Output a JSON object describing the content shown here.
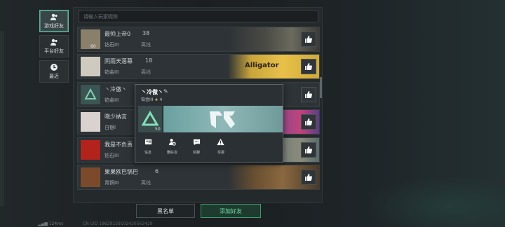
{
  "sidebar": {
    "tabs": [
      {
        "label": "游戏好友",
        "icon": "users-icon",
        "active": true
      },
      {
        "label": "平台好友",
        "icon": "users-icon",
        "active": false
      },
      {
        "label": "最近",
        "icon": "clock-icon",
        "active": false
      }
    ]
  },
  "search": {
    "placeholder": "请输入玩家昵称"
  },
  "friends": [
    {
      "name": "最帅上帝0",
      "count": "38",
      "rank": "钻石III",
      "status": "离线",
      "level": "60"
    },
    {
      "name": "阴雨天落幕",
      "count": "18",
      "rank": "铂金III",
      "status": "离线",
      "level": "",
      "banner_text": "Alligator"
    },
    {
      "name": "丶冷傲丶",
      "count": "",
      "rank": "铂金III",
      "status": "",
      "level": ""
    },
    {
      "name": "晓少纳言",
      "count": "",
      "rank": "白银I",
      "status": "",
      "level": ""
    },
    {
      "name": "我是不负责",
      "count": "",
      "rank": "钻石III",
      "status": "",
      "level": ""
    },
    {
      "name": "果果欧巴锅巴",
      "count": "6",
      "rank": "青铜III",
      "status": "离线",
      "level": ""
    }
  ],
  "popup": {
    "name": "丶冷傲丶",
    "rank": "铂金III",
    "stars": "4",
    "level": "50",
    "actions": [
      {
        "label": "信息",
        "icon": "profile-card-icon"
      },
      {
        "label": "删好友",
        "icon": "remove-user-icon"
      },
      {
        "label": "私聊",
        "icon": "chat-icon"
      },
      {
        "label": "举报",
        "icon": "warning-icon"
      }
    ]
  },
  "buttons": {
    "blacklist": "黑名单",
    "add_friend": "添加好友"
  },
  "footer": {
    "ping": "124ms",
    "uid": "CN UID 18629159102420562429"
  },
  "colors": {
    "accent": "#5fd39a",
    "like_bg": "#2f3538"
  }
}
